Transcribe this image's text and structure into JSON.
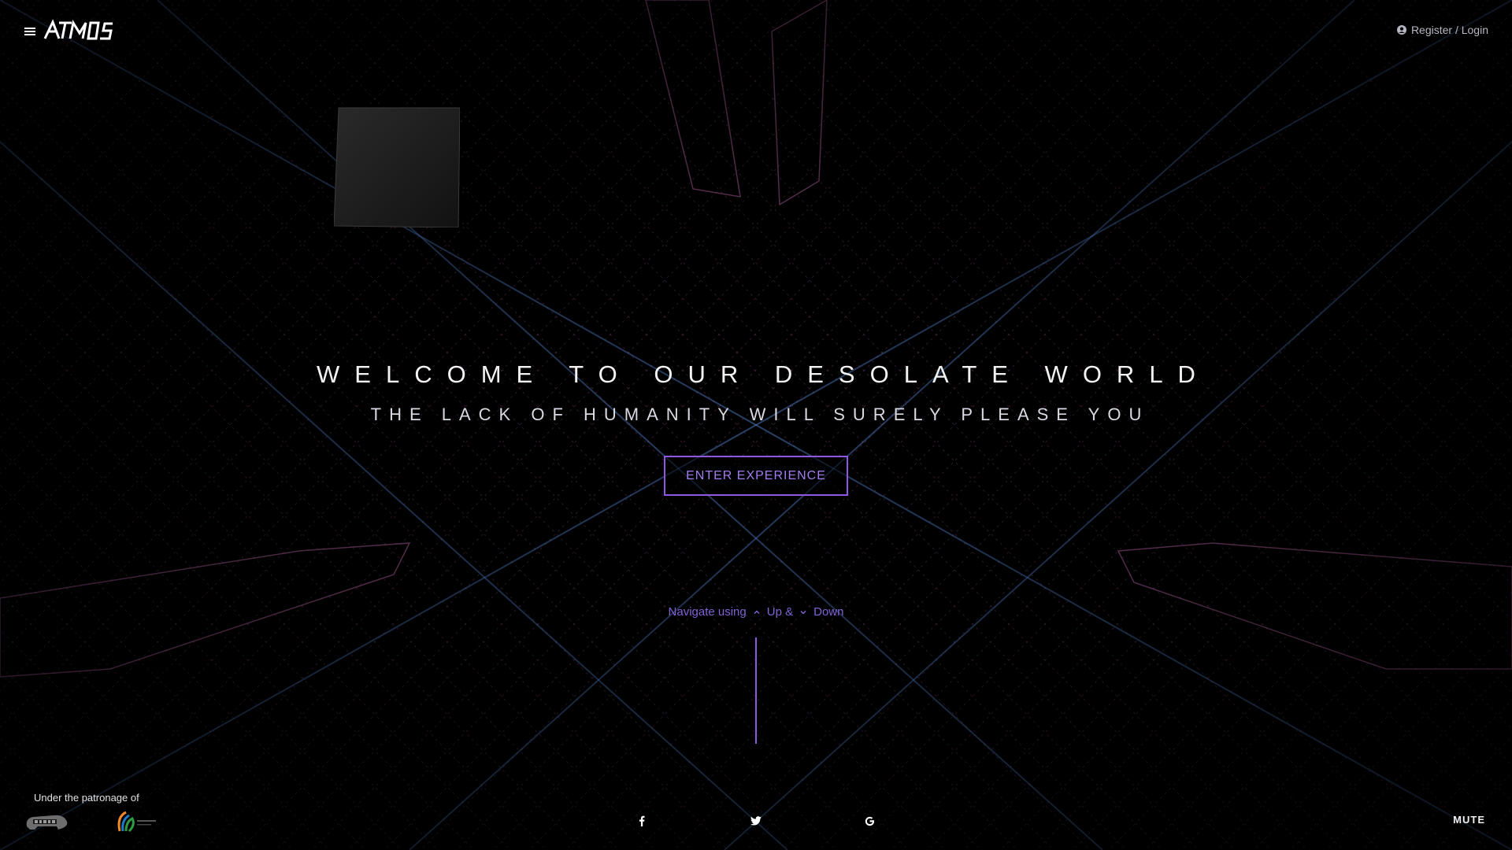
{
  "header": {
    "logo_text": "ATMOS",
    "auth_label": "Register / Login"
  },
  "hero": {
    "title": "WELCOME TO OUR DESOLATE WORLD",
    "subtitle": "THE LACK OF HUMANITY WILL SURELY PLEASE YOU",
    "cta_label": "ENTER EXPERIENCE"
  },
  "navigation_hint": {
    "prefix": "Navigate using",
    "up_label": "Up &",
    "down_label": "Down"
  },
  "footer": {
    "patronage_label": "Under the patronage of",
    "patron_logos": [
      "make-in-india-logo",
      "digital-india-logo"
    ],
    "social_icons": [
      "facebook-icon",
      "twitter-icon",
      "google-icon"
    ],
    "mute_label": "MUTE"
  },
  "colors": {
    "accent": "#8e58e0",
    "accent_text": "#a27cf0",
    "background": "#000000",
    "grid_pink": "#c76bb0",
    "grid_blue": "#5a8fe0"
  }
}
